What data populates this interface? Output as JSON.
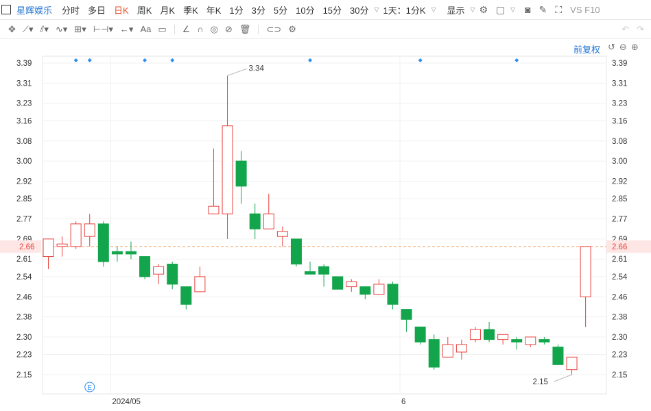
{
  "header": {
    "stock_name": "星辉娱乐",
    "periods": [
      "分时",
      "多日",
      "日K",
      "周K",
      "月K",
      "季K",
      "年K",
      "1分",
      "3分",
      "5分",
      "10分",
      "15分",
      "30分"
    ],
    "active_period": "日K",
    "multi_label": "1天：1分K",
    "display_label": "显示",
    "f10_label": "VS F10"
  },
  "toolbar": {
    "font_label": "Aa"
  },
  "adjust_label": "前复权",
  "colors": {
    "up": "#e8413c",
    "down": "#12a54c",
    "dash": "#f3a063",
    "marker": "#2d8cf0"
  },
  "chart_data": {
    "type": "candlestick",
    "y_ticks": [
      "3.39",
      "3.31",
      "3.23",
      "3.16",
      "3.08",
      "3.00",
      "2.92",
      "2.85",
      "2.77",
      "2.69",
      "2.61",
      "2.54",
      "2.46",
      "2.38",
      "2.30",
      "2.23",
      "2.15"
    ],
    "x_labels": [
      {
        "label": "2024/05",
        "index": 5
      },
      {
        "label": "6",
        "index": 26
      }
    ],
    "current_price": "2.66",
    "high_label": "3.34",
    "low_label": "2.15",
    "event_marker": "E",
    "event_index": 3,
    "dividend_marker_indices": [
      2,
      3,
      7,
      9,
      19,
      27,
      34
    ],
    "candles": [
      {
        "o": 2.62,
        "c": 2.69,
        "h": 2.69,
        "l": 2.57
      },
      {
        "o": 2.66,
        "c": 2.67,
        "h": 2.7,
        "l": 2.62
      },
      {
        "o": 2.66,
        "c": 2.75,
        "h": 2.76,
        "l": 2.65
      },
      {
        "o": 2.7,
        "c": 2.75,
        "h": 2.79,
        "l": 2.66
      },
      {
        "o": 2.75,
        "c": 2.6,
        "h": 2.76,
        "l": 2.58
      },
      {
        "o": 2.64,
        "c": 2.63,
        "h": 2.66,
        "l": 2.6
      },
      {
        "o": 2.64,
        "c": 2.63,
        "h": 2.68,
        "l": 2.61
      },
      {
        "o": 2.62,
        "c": 2.54,
        "h": 2.62,
        "l": 2.53
      },
      {
        "o": 2.55,
        "c": 2.58,
        "h": 2.59,
        "l": 2.51
      },
      {
        "o": 2.59,
        "c": 2.51,
        "h": 2.6,
        "l": 2.49
      },
      {
        "o": 2.5,
        "c": 2.43,
        "h": 2.5,
        "l": 2.41
      },
      {
        "o": 2.48,
        "c": 2.54,
        "h": 2.58,
        "l": 2.48
      },
      {
        "o": 2.79,
        "c": 2.82,
        "h": 3.05,
        "l": 2.79
      },
      {
        "o": 2.79,
        "c": 3.14,
        "h": 3.34,
        "l": 2.69
      },
      {
        "o": 3.0,
        "c": 2.9,
        "h": 3.04,
        "l": 2.83
      },
      {
        "o": 2.79,
        "c": 2.73,
        "h": 2.83,
        "l": 2.69
      },
      {
        "o": 2.73,
        "c": 2.79,
        "h": 2.87,
        "l": 2.73
      },
      {
        "o": 2.7,
        "c": 2.72,
        "h": 2.74,
        "l": 2.66
      },
      {
        "o": 2.69,
        "c": 2.59,
        "h": 2.69,
        "l": 2.58
      },
      {
        "o": 2.56,
        "c": 2.55,
        "h": 2.6,
        "l": 2.55
      },
      {
        "o": 2.58,
        "c": 2.55,
        "h": 2.59,
        "l": 2.5
      },
      {
        "o": 2.54,
        "c": 2.49,
        "h": 2.54,
        "l": 2.49
      },
      {
        "o": 2.5,
        "c": 2.52,
        "h": 2.53,
        "l": 2.48
      },
      {
        "o": 2.5,
        "c": 2.47,
        "h": 2.5,
        "l": 2.45
      },
      {
        "o": 2.47,
        "c": 2.51,
        "h": 2.53,
        "l": 2.47
      },
      {
        "o": 2.51,
        "c": 2.43,
        "h": 2.52,
        "l": 2.41
      },
      {
        "o": 2.41,
        "c": 2.37,
        "h": 2.41,
        "l": 2.32
      },
      {
        "o": 2.34,
        "c": 2.28,
        "h": 2.34,
        "l": 2.27
      },
      {
        "o": 2.29,
        "c": 2.18,
        "h": 2.31,
        "l": 2.17
      },
      {
        "o": 2.22,
        "c": 2.27,
        "h": 2.3,
        "l": 2.22
      },
      {
        "o": 2.24,
        "c": 2.27,
        "h": 2.29,
        "l": 2.21
      },
      {
        "o": 2.29,
        "c": 2.33,
        "h": 2.34,
        "l": 2.28
      },
      {
        "o": 2.33,
        "c": 2.29,
        "h": 2.36,
        "l": 2.28
      },
      {
        "o": 2.29,
        "c": 2.31,
        "h": 2.31,
        "l": 2.27
      },
      {
        "o": 2.29,
        "c": 2.28,
        "h": 2.3,
        "l": 2.25
      },
      {
        "o": 2.27,
        "c": 2.3,
        "h": 2.3,
        "l": 2.26
      },
      {
        "o": 2.29,
        "c": 2.28,
        "h": 2.3,
        "l": 2.27
      },
      {
        "o": 2.26,
        "c": 2.19,
        "h": 2.27,
        "l": 2.19
      },
      {
        "o": 2.17,
        "c": 2.22,
        "h": 2.22,
        "l": 2.15
      },
      {
        "o": 2.46,
        "c": 2.66,
        "h": 2.66,
        "l": 2.34
      }
    ]
  }
}
